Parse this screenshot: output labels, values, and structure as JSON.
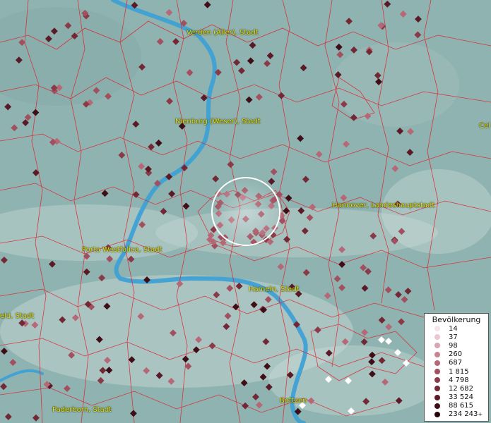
{
  "cities": [
    {
      "name": "Verden (Aller), Stadt"
    },
    {
      "name": "Nienburg (Weser), Stadt"
    },
    {
      "name": "Cel"
    },
    {
      "name": "Hannover, Landeshauptstadt"
    },
    {
      "name": "Porta Westfalica, Stadt"
    },
    {
      "name": "Hameln, Stadt"
    },
    {
      "name": "eld, Stadt"
    },
    {
      "name": "Paderborn, Stadt"
    },
    {
      "name": "Bottzen"
    }
  ],
  "legend": {
    "title": "Bevölkerung",
    "entries": [
      {
        "label": "14",
        "color": "#f7e4ea"
      },
      {
        "label": "37",
        "color": "#ecc6d0"
      },
      {
        "label": "98",
        "color": "#dba4b1"
      },
      {
        "label": "260",
        "color": "#c98493"
      },
      {
        "label": "687",
        "color": "#b66877"
      },
      {
        "label": "1 815",
        "color": "#a2505f"
      },
      {
        "label": "4 798",
        "color": "#8b3a48"
      },
      {
        "label": "12 682",
        "color": "#722835"
      },
      {
        "label": "33 524",
        "color": "#5a1a26"
      },
      {
        "label": "88 615",
        "color": "#3f0f18"
      },
      {
        "label": "234 243",
        "color": "#22050b",
        "suffix": "+"
      }
    ]
  },
  "colors": {
    "background": "#8fb3b0",
    "borders": "#e0202c",
    "river": "#3aa0d6",
    "label_text": "#e6e600",
    "highlight_circle": "#ffffff"
  }
}
